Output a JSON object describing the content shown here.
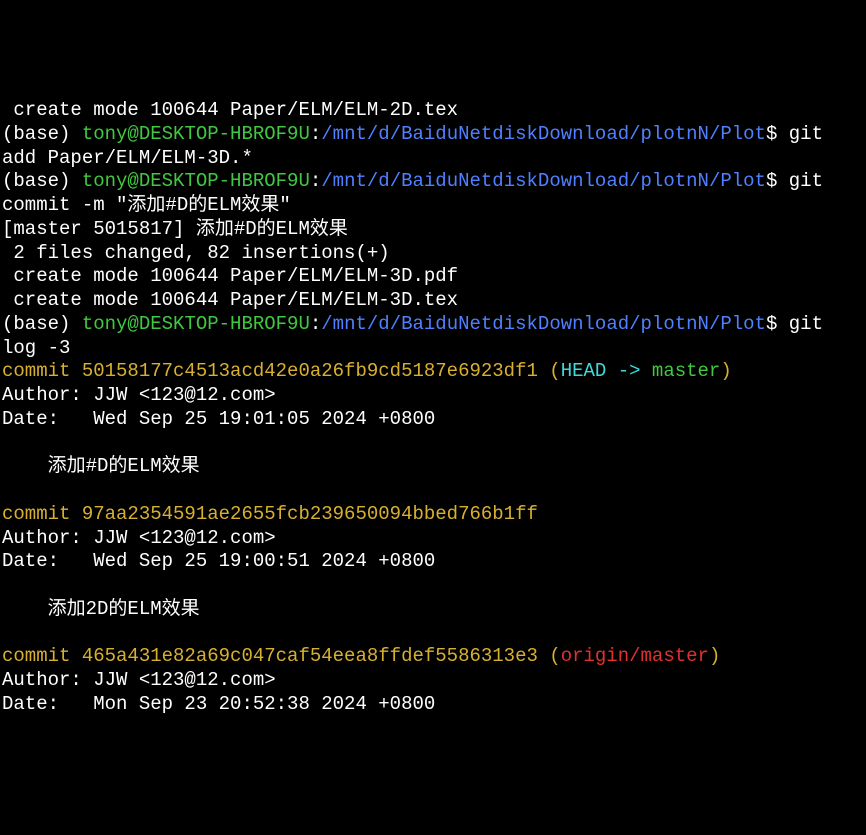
{
  "l1": " create mode 100644 Paper/ELM/ELM-2D.tex",
  "p_base": "(base) ",
  "p_user": "tony@DESKTOP-HBROF9U",
  "p_colon": ":",
  "p_path": "/mnt/d/BaiduNetdiskDownload/plotnN/Plot",
  "p_dollar": "$ ",
  "cmd1a": "git",
  "cmd1b": "add Paper/ELM/ELM-3D.*",
  "cmd2a": "git",
  "cmd2b": "commit -m \"添加#D的ELM效果\"",
  "out2a": "[master 5015817] 添加#D的ELM效果",
  "out2b": " 2 files changed, 82 insertions(+)",
  "out2c": " create mode 100644 Paper/ELM/ELM-3D.pdf",
  "out2d": " create mode 100644 Paper/ELM/ELM-3D.tex",
  "cmd3a": "git",
  "cmd3b": "log -3",
  "c1_commit": "commit 50158177c4513acd42e0a26fb9cd5187e6923df1",
  "c1_paren_open": " (",
  "c1_head": "HEAD -> ",
  "c1_master": "master",
  "c1_paren_close": ")",
  "c1_author": "Author: JJW <123@12.com>",
  "c1_date": "Date:   Wed Sep 25 19:01:05 2024 +0800",
  "c1_msg": "    添加#D的ELM效果",
  "c2_commit": "commit 97aa2354591ae2655fcb239650094bbed766b1ff",
  "c2_author": "Author: JJW <123@12.com>",
  "c2_date": "Date:   Wed Sep 25 19:00:51 2024 +0800",
  "c2_msg": "    添加2D的ELM效果",
  "c3_commit": "commit 465a431e82a69c047caf54eea8ffdef5586313e3",
  "c3_paren_open": " (",
  "c3_ref": "origin/master",
  "c3_paren_close": ")",
  "c3_author": "Author: JJW <123@12.com>",
  "c3_date": "Date:   Mon Sep 23 20:52:38 2024 +0800"
}
